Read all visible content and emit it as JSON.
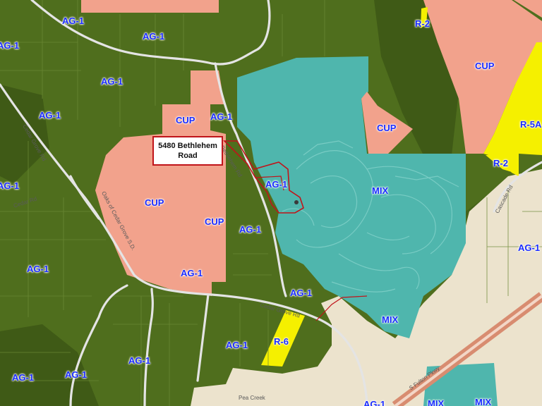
{
  "map": {
    "callout": {
      "line1": "5480 Bethlehem",
      "line2": "Road"
    },
    "zone_labels": {
      "ag1_a": "AG-1",
      "ag1_b": "AG-1",
      "ag1_c": "AG-1",
      "ag1_d": "AG-1",
      "ag1_e": "AG-1",
      "ag1_f": "AG-1",
      "ag1_g": "AG-1",
      "ag1_h": "AG-1",
      "ag1_i": "AG-1",
      "ag1_j": "AG-1",
      "ag1_k": "AG-1",
      "ag1_l": "AG-1",
      "ag1_m": "AG-1",
      "ag1_n": "AG-1",
      "ag1_o": "AG-1",
      "ag1_p": "AG-1",
      "ag1_q": "AG-1",
      "ag1_r": "AG-1",
      "ag1_s": "AG-1",
      "cup_a": "CUP",
      "cup_b": "CUP",
      "cup_c": "CUP",
      "cup_d": "CUP",
      "cup_e": "CUP",
      "mix_a": "MIX",
      "mix_b": "MIX",
      "mix_c": "MIX",
      "mix_d": "MIX",
      "r2_a": "R-2",
      "r2_b": "R-2",
      "r5a": "R-5A",
      "r6": "R-6"
    },
    "street_labels": {
      "bethlehem": "Bethlehem Rd",
      "cedar_grove": "Cedar Grove Rd",
      "cedar_sd": "Oaks of Cedar Grove S.D.",
      "fulton": "S Fulton Pkwy",
      "pea_creek": "Pea Creek",
      "left_road": "Cedar Grove Rd",
      "short_left": "Cedar Rd",
      "right_road": "Cascade Rd"
    },
    "colors": {
      "ag": "#4f6e1d",
      "ag_dark": "#3f5a16",
      "cup": "#f2a28c",
      "mix": "#4fb6ad",
      "residential": "#f5f000",
      "developed": "#ece3cd",
      "subject_outline": "#c0141a",
      "label": "#1a2cff"
    }
  }
}
